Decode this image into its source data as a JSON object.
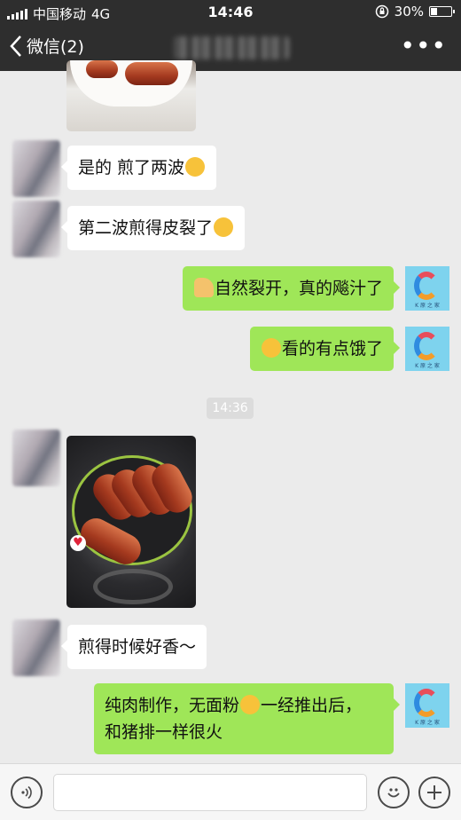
{
  "status_bar": {
    "carrier": "中国移动",
    "network": "4G",
    "time": "14:46",
    "battery": "30%",
    "battery_level": 0.3
  },
  "nav": {
    "back_label": "微信(2)",
    "more_label": "•••"
  },
  "messages": [
    {
      "side": "left",
      "type": "image",
      "subject": "sausages on plate"
    },
    {
      "side": "left",
      "type": "text",
      "text": "是的 煎了两波",
      "emoji": "joy-emoji"
    },
    {
      "side": "left",
      "type": "text",
      "text": "第二波煎得皮裂了",
      "emoji": "joy-emoji"
    },
    {
      "side": "right",
      "type": "text",
      "emoji": "thumbs-up-emoji",
      "text": "自然裂开，真的飚汁了"
    },
    {
      "side": "right",
      "type": "text",
      "emoji": "hungry-emoji",
      "text": "看的有点饿了"
    },
    {
      "type": "timestamp",
      "text": "14:36"
    },
    {
      "side": "left",
      "type": "image",
      "subject": "sausages frying in pan"
    },
    {
      "side": "left",
      "type": "text",
      "text": "煎得时候好香～"
    },
    {
      "side": "right",
      "type": "text",
      "text_part1": "纯肉制作，无面粉",
      "emoji": "flushed-emoji",
      "text_part2": "一经推出后，",
      "text_line2": "和猪排一样很火"
    }
  ],
  "input_bar": {
    "voice_icon": "voice-icon",
    "emoji_icon": "smiley-icon",
    "plus_icon": "plus-icon"
  },
  "colors": {
    "bar_dark": "#2e2e2e",
    "chat_bg": "#ebebeb",
    "bubble_sent": "#9fe658",
    "bubble_received": "#ffffff"
  }
}
